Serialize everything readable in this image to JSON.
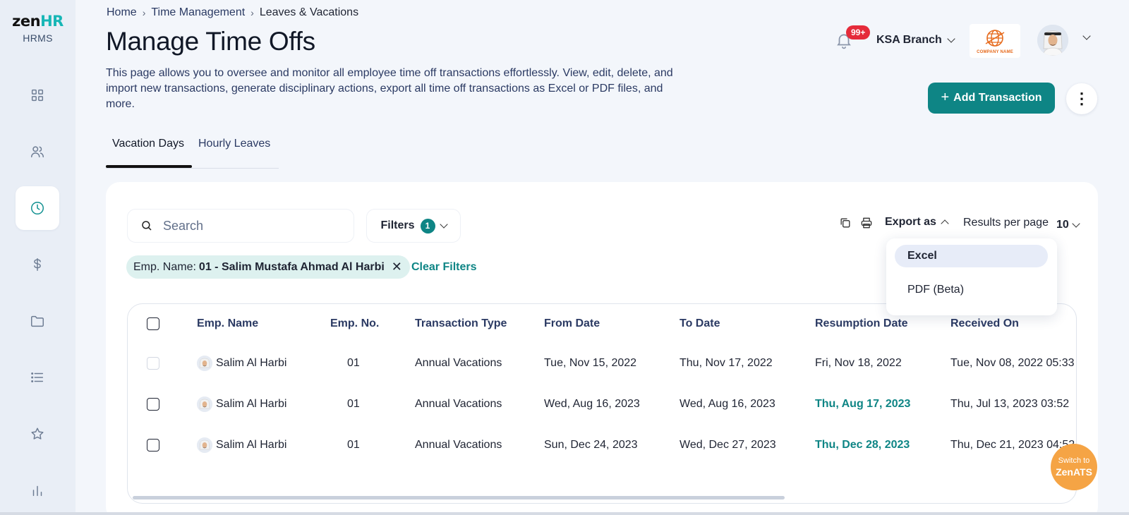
{
  "brand": {
    "zen": "zen",
    "hr": "HR",
    "product": "HRMS"
  },
  "sidebar": {
    "items": [
      {
        "name": "dashboard",
        "icon": "grid-icon"
      },
      {
        "name": "employees",
        "icon": "users-icon"
      },
      {
        "name": "time-management",
        "icon": "clock-icon",
        "active": true
      },
      {
        "name": "payroll",
        "icon": "dollar-icon"
      },
      {
        "name": "documents",
        "icon": "folder-icon"
      },
      {
        "name": "lists",
        "icon": "list-icon"
      },
      {
        "name": "performance",
        "icon": "star-icon"
      },
      {
        "name": "reports",
        "icon": "bar-chart-icon"
      }
    ]
  },
  "breadcrumb": [
    "Home",
    "Time Management",
    "Leaves & Vacations"
  ],
  "page": {
    "title": "Manage Time Offs",
    "description": "This page allows you to oversee and monitor all employee time off transactions effortlessly. View, edit, delete, and import new transactions, generate disciplinary actions, export all time off transactions as Excel or PDF files, and more."
  },
  "header": {
    "notification_count": "99+",
    "branch": "KSA Branch",
    "company_logo_text": "COMPANY NAME"
  },
  "actions": {
    "add_transaction": "Add Transaction"
  },
  "tabs": [
    {
      "label": "Vacation Days",
      "active": true
    },
    {
      "label": "Hourly Leaves",
      "active": false
    }
  ],
  "toolbar": {
    "search_placeholder": "Search",
    "filters_label": "Filters",
    "filters_count": "1",
    "export_label": "Export as",
    "results_per_page_label": "Results per page",
    "results_per_page_value": "10"
  },
  "active_filter": {
    "key": "Emp. Name:",
    "value": "01 - Salim Mustafa Ahmad Al Harbi"
  },
  "clear_filters": "Clear Filters",
  "export_menu": {
    "items": [
      "Excel",
      "PDF (Beta)"
    ],
    "highlighted": "Excel"
  },
  "table": {
    "columns": [
      "Emp. Name",
      "Emp. No.",
      "Transaction Type",
      "From Date",
      "To Date",
      "Resumption Date",
      "Received On"
    ],
    "rows": [
      {
        "name": "Salim Al Harbi",
        "no": "01",
        "type": "Annual Vacations",
        "from": "Tue, Nov 15, 2022",
        "to": "Thu, Nov 17, 2022",
        "resumption": "Fri, Nov 18, 2022",
        "received": "Tue, Nov 08, 2022 05:33"
      },
      {
        "name": "Salim Al Harbi",
        "no": "01",
        "type": "Annual Vacations",
        "from": "Wed, Aug 16, 2023",
        "to": "Wed, Aug 16, 2023",
        "resumption": "Thu, Aug 17, 2023",
        "received": "Thu, Jul 13, 2023 03:52"
      },
      {
        "name": "Salim Al Harbi",
        "no": "01",
        "type": "Annual Vacations",
        "from": "Sun, Dec 24, 2023",
        "to": "Wed, Dec 27, 2023",
        "resumption": "Thu, Dec 28, 2023",
        "received": "Thu, Dec 21, 2023 04:52"
      }
    ]
  },
  "switch_ats": {
    "line1": "Switch to",
    "line2": "ZenATS"
  },
  "colors": {
    "accent": "#0e8585",
    "badge": "#e52b3a",
    "ats": "#f5a445"
  }
}
